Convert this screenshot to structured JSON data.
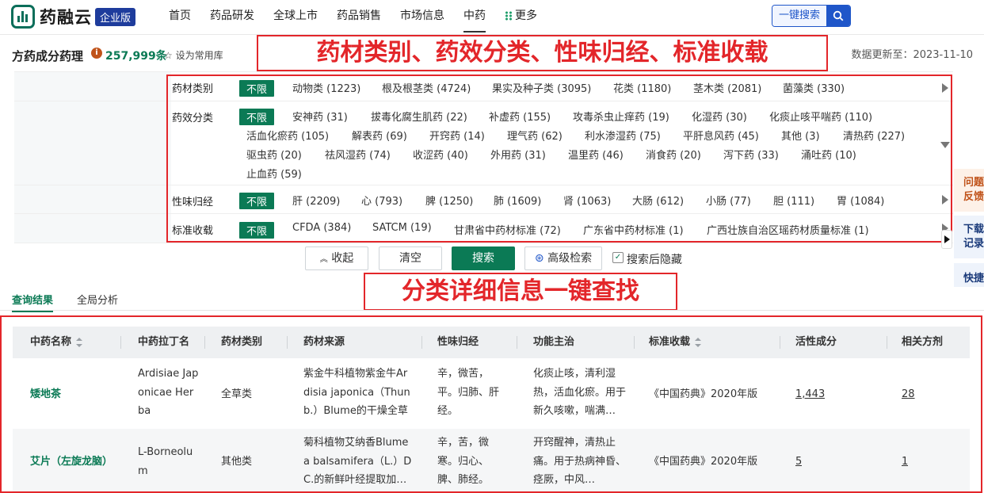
{
  "nav": {
    "logo_text": "药融云",
    "badge": "企业版",
    "menu": [
      "首页",
      "药品研发",
      "全球上市",
      "药品销售",
      "市场信息",
      "中药",
      "更多"
    ],
    "search_label": "一键搜索"
  },
  "header": {
    "title": "方药成分药理",
    "info_icon_char": "i",
    "count": "257,999条",
    "favorite": "设为常用库",
    "update": "数据更新至：2023-11-10"
  },
  "annotations": {
    "top": "药材类别、药效分类、性味归经、标准收载",
    "middle": "分类详细信息一键查找"
  },
  "filters": [
    {
      "label": "药材类别",
      "items": [
        "不限",
        "动物类 (1223)",
        "根及根茎类 (4724)",
        "果实及种子类 (3095)",
        "花类 (1180)",
        "茎木类 (2081)",
        "菌藻类 (330)"
      ]
    },
    {
      "label": "药效分类",
      "items": [
        "不限",
        "安神药 (31)",
        "拔毒化腐生肌药 (22)",
        "补虚药 (155)",
        "攻毒杀虫止痒药 (19)",
        "化湿药 (30)",
        "化痰止咳平喘药 (110)",
        "活血化瘀药 (105)",
        "解表药 (69)",
        "开窍药 (14)",
        "理气药 (62)",
        "利水渗湿药 (75)",
        "平肝息风药 (45)",
        "其他 (3)",
        "清热药 (227)",
        "驱虫药 (20)",
        "祛风湿药 (74)",
        "收涩药 (40)",
        "外用药 (31)",
        "温里药 (46)",
        "消食药 (20)",
        "泻下药 (33)",
        "涌吐药 (10)",
        "止血药 (59)"
      ]
    },
    {
      "label": "性味归经",
      "items": [
        "不限",
        "肝 (2209)",
        "心 (793)",
        "脾 (1250)",
        "肺 (1609)",
        "肾 (1063)",
        "大肠 (612)",
        "小肠 (77)",
        "胆 (111)",
        "胃 (1084)"
      ]
    },
    {
      "label": "标准收载",
      "items": [
        "不限",
        "CFDA (384)",
        "SATCM (19)",
        "甘肃省中药材标准 (72)",
        "广东省中药材标准 (1)",
        "广西壮族自治区瑶药材质量标准 (1)"
      ]
    }
  ],
  "buttons": {
    "collapse": "收起",
    "clear": "清空",
    "search": "搜索",
    "advanced": "高级检索",
    "hide_after": "搜索后隐藏"
  },
  "tabs": [
    "查询结果",
    "全局分析"
  ],
  "table": {
    "headers": [
      "中药名称",
      "中药拉丁名",
      "药材类别",
      "药材来源",
      "性味归经",
      "功能主治",
      "标准收载",
      "活性成分",
      "相关方剂"
    ],
    "rows": [
      {
        "name": "矮地茶",
        "latin": "Ardisiae Japonicae Herba",
        "category": "全草类",
        "source": "紫金牛科植物紫金牛Ardisia japonica（Thunb.）Blume的干燥全草",
        "taste": "辛，微苦，平。归肺、肝经。",
        "function": "化痰止咳，清利湿热，活血化瘀。用于新久咳嗽，喘满…",
        "standard": "《中国药典》2020年版",
        "active": "1,443",
        "related": "28"
      },
      {
        "name": "艾片（左旋龙脑）",
        "latin": "L-Borneolum",
        "category": "其他类",
        "source": "菊科植物艾纳香Blumea balsamifera（L.）DC.的新鲜叶经提取加…",
        "taste": "辛，苦，微寒。归心、脾、肺经。",
        "function": "开窍醒神，清热止痛。用于热病神昏、痉厥，中风…",
        "standard": "《中国药典》2020年版",
        "active": "5",
        "related": "1"
      }
    ]
  },
  "side": [
    "问题反馈",
    "下载记录",
    "快捷"
  ]
}
